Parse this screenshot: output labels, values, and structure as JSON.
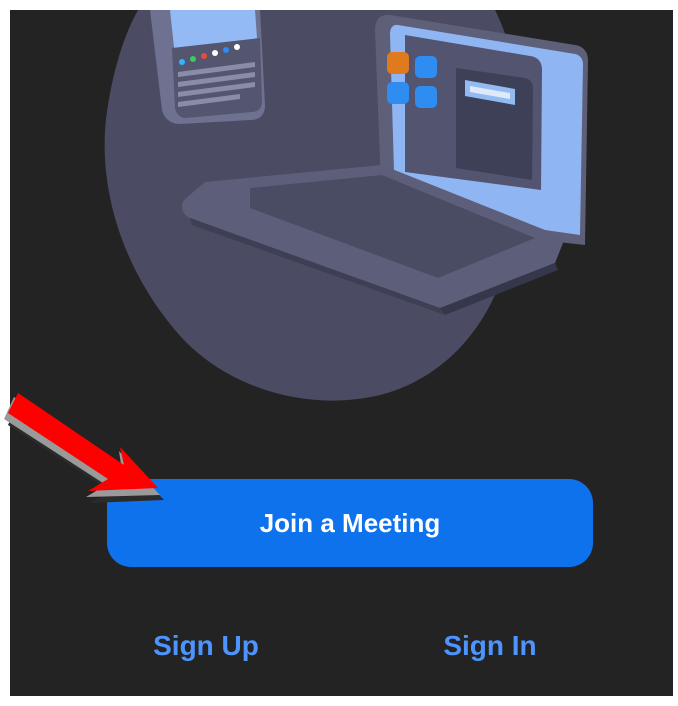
{
  "main": {
    "join_button_label": "Join a Meeting",
    "sign_up_label": "Sign Up",
    "sign_in_label": "Sign In"
  },
  "colors": {
    "background": "#232323",
    "primary_button": "#0e72ed",
    "link_text": "#4d94ff",
    "annotation_arrow": "#ff0000"
  },
  "icons": {
    "hero": "laptop-illustration",
    "annotation": "red-pointer-arrow-icon"
  }
}
